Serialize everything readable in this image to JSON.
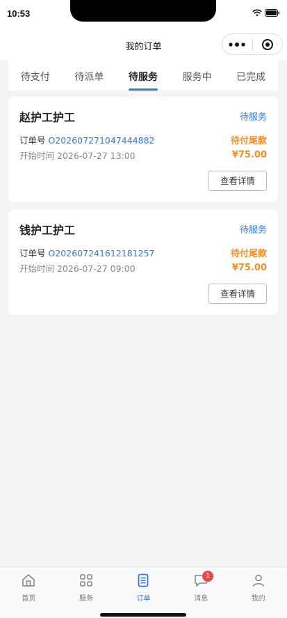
{
  "status_bar": {
    "time": "10:53"
  },
  "nav": {
    "title": "我的订单"
  },
  "tabs": [
    {
      "label": "待支付",
      "active": false
    },
    {
      "label": "待派单",
      "active": false
    },
    {
      "label": "待服务",
      "active": true
    },
    {
      "label": "服务中",
      "active": false
    },
    {
      "label": "已完成",
      "active": false
    }
  ],
  "orders": [
    {
      "name": "赵护工护工",
      "status": "待服务",
      "order_no_label": "订单号",
      "order_no": "O202607271047444882",
      "start_time_label": "开始时间",
      "start_time": "2026-07-27 13:00",
      "pay_status": "待付尾款",
      "amount": "¥75.00",
      "detail_label": "查看详情"
    },
    {
      "name": "钱护工护工",
      "status": "待服务",
      "order_no_label": "订单号",
      "order_no": "O202607241612181257",
      "start_time_label": "开始时间",
      "start_time": "2026-07-27 09:00",
      "pay_status": "待付尾款",
      "amount": "¥75.00",
      "detail_label": "查看详情"
    }
  ],
  "tabbar": [
    {
      "label": "首页",
      "icon": "home-icon",
      "active": false
    },
    {
      "label": "服务",
      "icon": "grid-icon",
      "active": false
    },
    {
      "label": "订单",
      "icon": "document-icon",
      "active": true
    },
    {
      "label": "消息",
      "icon": "chat-icon",
      "active": false,
      "badge": "1"
    },
    {
      "label": "我的",
      "icon": "user-icon",
      "active": false
    }
  ],
  "colors": {
    "accent": "#2f7ad9",
    "warning": "#f0902a",
    "badge": "#e84a4a"
  }
}
